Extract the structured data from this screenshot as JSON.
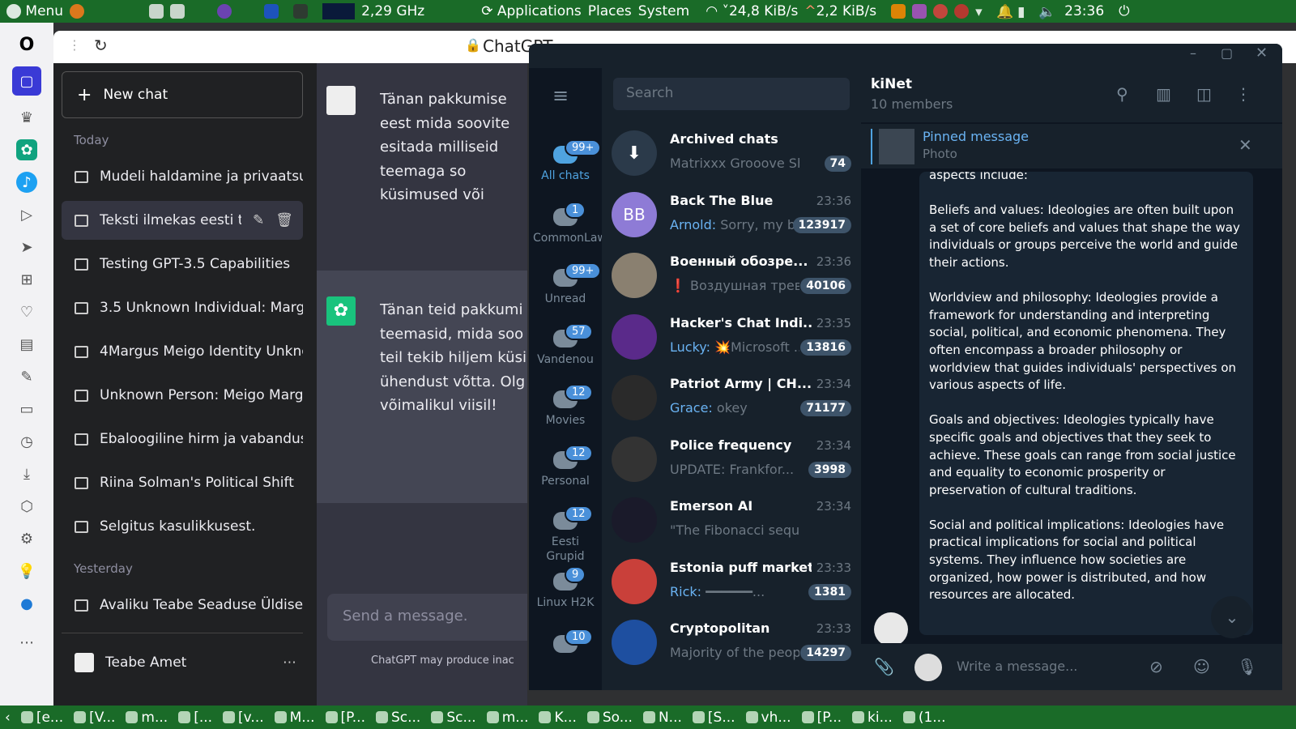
{
  "topbar": {
    "menu": "Menu",
    "cpu": "2,29 GHz",
    "applications": "Applications",
    "places": "Places",
    "system": "System",
    "down": "24,8 KiB/s",
    "up": "2,2 KiB/s",
    "time": "23:36"
  },
  "browser": {
    "tab_title": "ChatGPT"
  },
  "gpt": {
    "new_chat": "New chat",
    "today": "Today",
    "yesterday": "Yesterday",
    "items": [
      "Mudeli haldamine ja privaatsu",
      "Teksti ilmekas eesti tõl",
      "Testing GPT-3.5 Capabilities",
      "3.5 Unknown Individual: Margu",
      "4Margus Meigo Identity Unkno",
      "Unknown Person: Meigo Marg",
      "Ebaloogiline hirm ja vabandus",
      "Riina Solman's Political Shift",
      "Selgitus kasulikkusest."
    ],
    "yesterday_items": [
      "Avaliku Teabe Seaduse Üldise"
    ],
    "user": "Teabe Amet",
    "msg1": "Tänan pakkumise eest mida soovite esitada milliseid teemaga so küsimused või spets pakkuda teile asjako",
    "msg2": "Tänan teid pakkumi teemasid, mida soo teil tekib hiljem küsi ühendust võtta. Olg võimalikul viisil!",
    "placeholder": "Send a message.",
    "disclaimer": "ChatGPT may produce inac"
  },
  "tg": {
    "folders": [
      {
        "label": "All chats",
        "badge": "99+"
      },
      {
        "label": "CommonLawCLC",
        "badge": "1"
      },
      {
        "label": "Unread",
        "badge": "99+"
      },
      {
        "label": "Vandenou",
        "badge": "57"
      },
      {
        "label": "Movies",
        "badge": "12"
      },
      {
        "label": "Personal",
        "badge": "12"
      },
      {
        "label": "Eesti Grupid",
        "badge": "12"
      },
      {
        "label": "Linux H2K",
        "badge": "9"
      },
      {
        "label": "",
        "badge": "10"
      }
    ],
    "search": "Search",
    "chats": [
      {
        "name": "Archived chats",
        "time": "",
        "sender": "",
        "preview": "Matrixxx Grooove Sho...",
        "count": "74",
        "avatar": "",
        "color": "#2b3a4a"
      },
      {
        "name": "Back The Blue",
        "time": "23:36",
        "sender": "Arnold:",
        "preview": "Sorry, my b...",
        "count": "123917",
        "avatar": "BB",
        "color": "#8e7bd6"
      },
      {
        "name": "Военный обозре...",
        "time": "23:36",
        "sender": "",
        "preview": "❗ Воздушная трев...",
        "count": "40106",
        "avatar": "",
        "color": "#8a8070"
      },
      {
        "name": "Hacker's Chat Indi...",
        "time": "23:35",
        "sender": "Lucky:",
        "preview": "💥Microsoft ...",
        "count": "13816",
        "avatar": "",
        "color": "#5a2a8a"
      },
      {
        "name": "Patriot Army | CH...",
        "time": "23:34",
        "sender": "Grace:",
        "preview": "okey",
        "count": "71177",
        "avatar": "",
        "color": "#2a2a2a"
      },
      {
        "name": "Police frequency",
        "time": "23:34",
        "sender": "",
        "preview": "UPDATE: Frankfor...",
        "count": "3998",
        "avatar": "",
        "color": "#333"
      },
      {
        "name": "Emerson AI",
        "time": "23:34",
        "sender": "",
        "preview": "\"The Fibonacci sequence do...",
        "count": "",
        "avatar": "",
        "color": "#1a1a2a"
      },
      {
        "name": "Estonia puff market",
        "time": "23:33",
        "sender": "Rick:",
        "preview": "━━━━━━...",
        "count": "1381",
        "avatar": "",
        "color": "#c9403a"
      },
      {
        "name": "Cryptopolitan",
        "time": "23:33",
        "sender": "",
        "preview": "Majority of the peop...",
        "count": "14297",
        "avatar": "",
        "color": "#1e4fa0"
      }
    ],
    "conv_title": "kiNet",
    "conv_members": "10 members",
    "pinned_label": "Pinned message",
    "pinned_sub": "Photo",
    "msg_text": "aspects include:\n\nBeliefs and values: Ideologies are often built upon a set of core beliefs and values that shape the way individuals or groups perceive the world and guide their actions.\n\nWorldview and philosophy: Ideologies provide a framework for understanding and interpreting social, political, and economic phenomena. They often encompass a broader philosophy or worldview that guides individuals' perspectives on various aspects of life.\n\nGoals and objectives: Ideologies typically have specific goals and objectives that they seek to achieve. These goals can range from social justice and equality to economic prosperity or preservation of cultural traditions.\n\nSocial and political implications: Ideologies have practical implications for social and political systems. They influence how societies are organized, how power is distributed, and how resources are allocated.",
    "compose": "Write a message..."
  },
  "taskbar": [
    "[e...",
    "[V...",
    "m...",
    "[...",
    "[v...",
    "M...",
    "[P...",
    "Sc...",
    "Sc...",
    "m...",
    "K...",
    "So...",
    "N...",
    "[S...",
    "vh...",
    "[P...",
    "ki...",
    "(1..."
  ]
}
